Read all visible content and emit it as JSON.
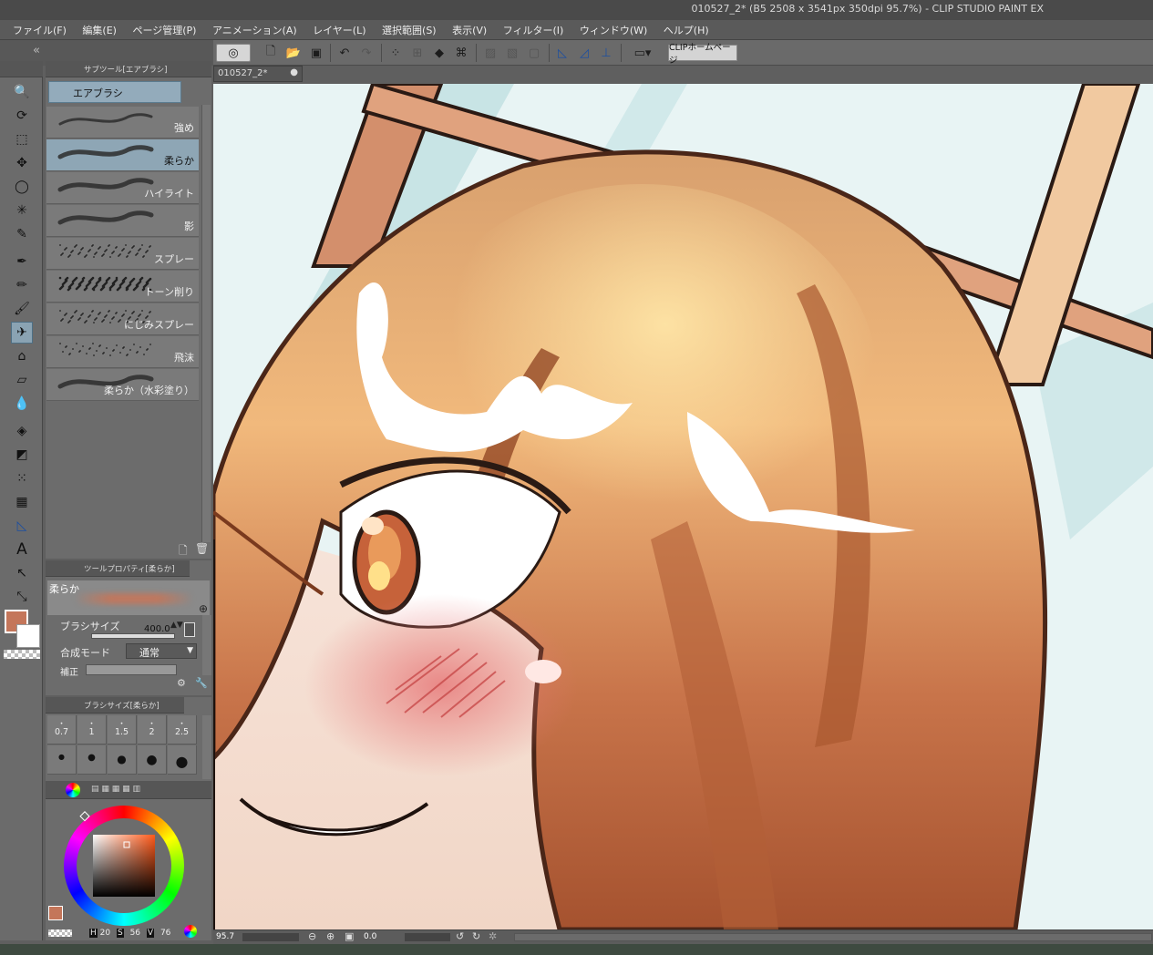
{
  "window": {
    "title": "010527_2* (B5 2508 x 3541px 350dpi 95.7%)  - CLIP STUDIO PAINT EX"
  },
  "menu": [
    "ファイル(F)",
    "編集(E)",
    "ページ管理(P)",
    "アニメーション(A)",
    "レイヤー(L)",
    "選択範囲(S)",
    "表示(V)",
    "フィルター(I)",
    "ウィンドウ(W)",
    "ヘルプ(H)"
  ],
  "toolbar": {
    "home_label": "CLIPホームページ"
  },
  "canvas_tab": {
    "label": "010527_2*"
  },
  "subtool": {
    "header": "サブツール[エアブラシ]",
    "group": "エアブラシ",
    "items": [
      {
        "label": "強め",
        "selected": false
      },
      {
        "label": "柔らか",
        "selected": true
      },
      {
        "label": "ハイライト",
        "selected": false
      },
      {
        "label": "影",
        "selected": false
      },
      {
        "label": "スプレー",
        "selected": false
      },
      {
        "label": "トーン削り",
        "selected": false
      },
      {
        "label": "にじみスプレー",
        "selected": false
      },
      {
        "label": "飛沫",
        "selected": false
      },
      {
        "label": "柔らか（水彩塗り）",
        "selected": false
      }
    ]
  },
  "toolprop": {
    "header": "ツールプロパティ[柔らか]",
    "preview_label": "柔らか",
    "brush_size_label": "ブラシサイズ",
    "brush_size_value": "400.0",
    "blend_label": "合成モード",
    "blend_value": "通常",
    "extra_label": "補正"
  },
  "brushsize": {
    "header": "ブラシサイズ[柔らか]",
    "row1": [
      "0.7",
      "1",
      "1.5",
      "2",
      "2.5"
    ]
  },
  "color": {
    "main": "#c4765a",
    "sub": "#ffffff",
    "h_label": "H",
    "h": "20",
    "s_label": "S",
    "s": "56",
    "v_label": "V",
    "v": "76"
  },
  "status": {
    "zoom": "95.7",
    "angle": "0.0"
  }
}
